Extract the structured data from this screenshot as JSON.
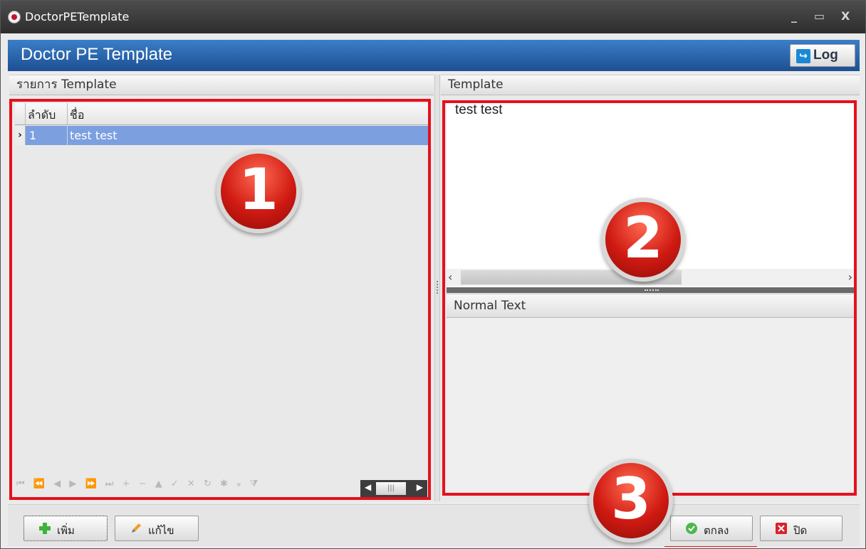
{
  "window": {
    "title": "DoctorPETemplate",
    "minimize": "_",
    "maximize": "▭",
    "close": "X"
  },
  "header": {
    "title": "Doctor PE Template",
    "log_label": "Log"
  },
  "left_panel": {
    "title": "รายการ Template",
    "columns": [
      "ลำดับ",
      "ชื่อ"
    ],
    "rows": [
      {
        "index": "1",
        "name": "test test"
      }
    ]
  },
  "right_panel": {
    "template_title": "Template",
    "template_text": "test test",
    "normal_text_title": "Normal Text",
    "normal_text": ""
  },
  "callouts": {
    "one": "1",
    "two": "2",
    "three": "3",
    "color": "#e5101c"
  },
  "footer": {
    "add_label": "เพิ่ม",
    "edit_label": "แก้ไข",
    "ok_label": "ตกลง",
    "close_label": "ปิด"
  },
  "colors": {
    "header_blue": "#1d4f92",
    "selected_row": "#7b9fdf",
    "highlight": "#e5101c"
  }
}
